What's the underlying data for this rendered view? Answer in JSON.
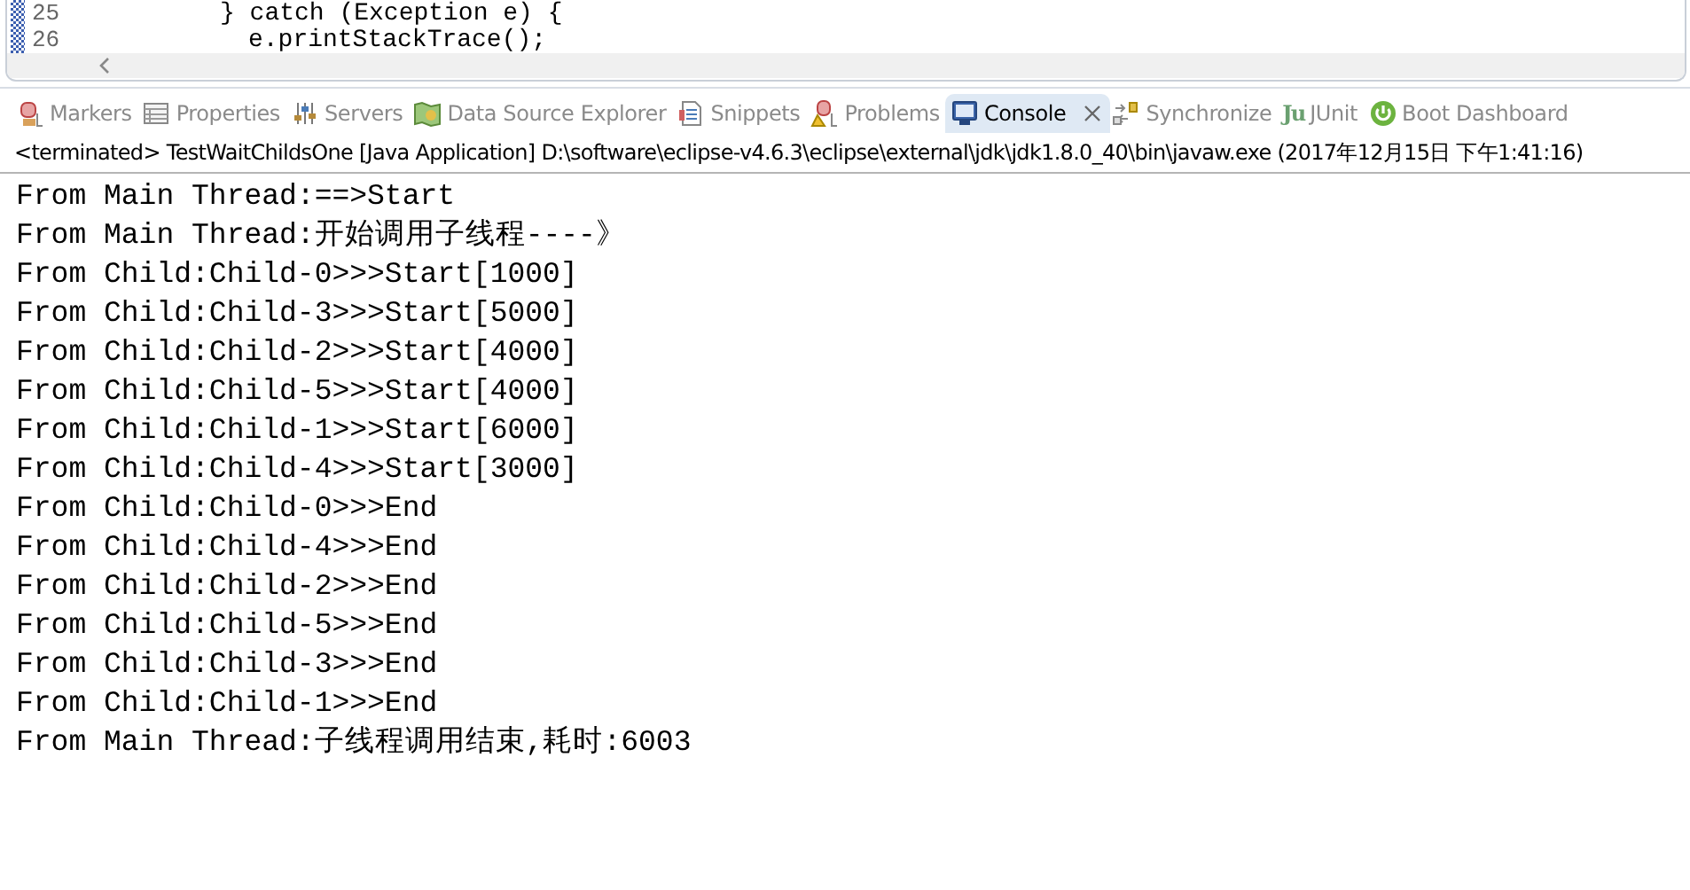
{
  "editor": {
    "lines": [
      {
        "number": "25",
        "code": "} catch (Exception e) {",
        "children": [
          {
            "number": "26",
            "code": "e.printStackTrace();"
          }
        ]
      }
    ]
  },
  "tabs": [
    {
      "label": "Markers",
      "kind": "markers",
      "selected": false
    },
    {
      "label": "Properties",
      "kind": "properties",
      "selected": false
    },
    {
      "label": "Servers",
      "kind": "servers",
      "selected": false
    },
    {
      "label": "Data Source Explorer",
      "kind": "datasource",
      "selected": false
    },
    {
      "label": "Snippets",
      "kind": "snippets",
      "selected": false
    },
    {
      "label": "Problems",
      "kind": "problems",
      "selected": false
    },
    {
      "label": "Console",
      "kind": "console",
      "selected": true
    },
    {
      "label": "Synchronize",
      "kind": "synchronize",
      "selected": false
    },
    {
      "label": "JUnit",
      "kind": "junit",
      "icon_text": "Ju",
      "selected": false
    },
    {
      "label": "Boot Dashboard",
      "kind": "boot",
      "selected": false
    }
  ],
  "console": {
    "status": "<terminated> TestWaitChildsOne [Java Application] D:\\software\\eclipse-v4.6.3\\eclipse\\external\\jdk\\jdk1.8.0_40\\bin\\javaw.exe (2017年12月15日 下午1:41:16)",
    "output": [
      "From Main Thread:==>Start",
      "From Main Thread:开始调用子线程----》",
      "From Child:Child-0>>>Start[1000]",
      "From Child:Child-3>>>Start[5000]",
      "From Child:Child-2>>>Start[4000]",
      "From Child:Child-5>>>Start[4000]",
      "From Child:Child-1>>>Start[6000]",
      "From Child:Child-4>>>Start[3000]",
      "From Child:Child-0>>>End",
      "From Child:Child-4>>>End",
      "From Child:Child-2>>>End",
      "From Child:Child-5>>>End",
      "From Child:Child-3>>>End",
      "From Child:Child-1>>>End",
      "From Main Thread:子线程调用结束,耗时:6003"
    ]
  }
}
